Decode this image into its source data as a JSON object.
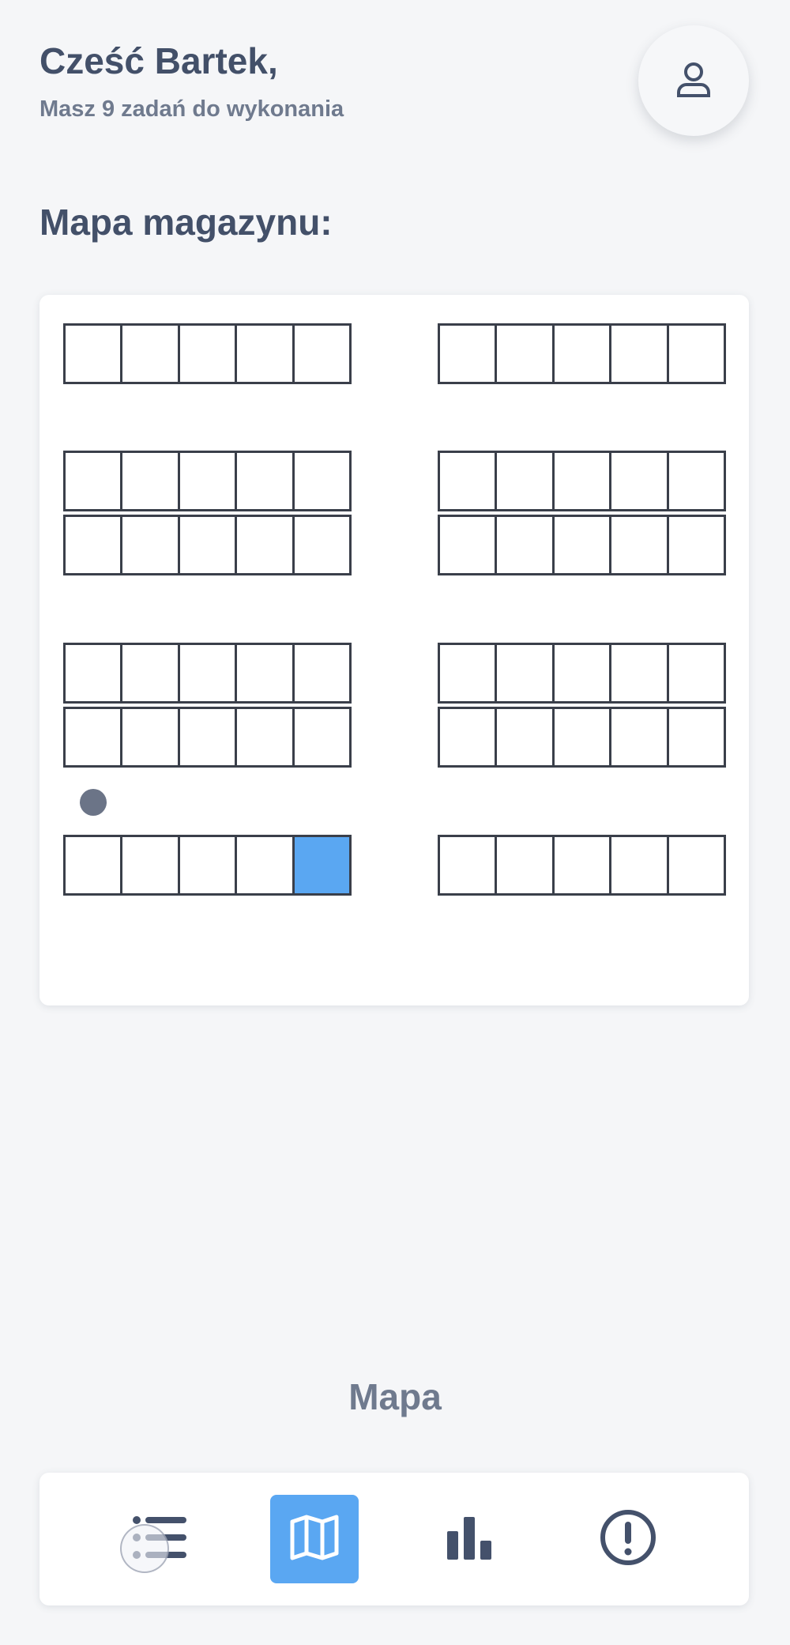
{
  "header": {
    "greeting": "Cześć Bartek,",
    "subtitle": "Masz 9 zadań do wykonania",
    "profile_icon": "user-icon"
  },
  "main": {
    "section_title": "Mapa magazynu:"
  },
  "warehouse_map": {
    "racks": [
      {
        "name": "rack-left-1",
        "cells": 5
      },
      {
        "name": "rack-right-1",
        "cells": 5
      },
      {
        "name": "rack-left-2a",
        "cells": 5
      },
      {
        "name": "rack-left-2b",
        "cells": 5
      },
      {
        "name": "rack-right-2a",
        "cells": 5
      },
      {
        "name": "rack-right-2b",
        "cells": 5
      },
      {
        "name": "rack-left-3a",
        "cells": 5
      },
      {
        "name": "rack-left-3b",
        "cells": 5
      },
      {
        "name": "rack-right-3a",
        "cells": 5
      },
      {
        "name": "rack-right-3b",
        "cells": 5
      },
      {
        "name": "rack-left-4",
        "cells": 5,
        "highlighted_cell": 5
      },
      {
        "name": "rack-right-4",
        "cells": 5
      }
    ],
    "highlight_color": "#5aa7f2",
    "worker_marker_color": "#6b7487"
  },
  "page_label": "Mapa",
  "bottom_nav": {
    "items": [
      {
        "name": "tasks-list",
        "icon": "list-icon",
        "active": false
      },
      {
        "name": "map",
        "icon": "map-icon",
        "active": true
      },
      {
        "name": "stats",
        "icon": "bar-chart-icon",
        "active": false
      },
      {
        "name": "alerts",
        "icon": "alert-icon",
        "active": false
      }
    ],
    "accent": "#5aa7f2"
  }
}
